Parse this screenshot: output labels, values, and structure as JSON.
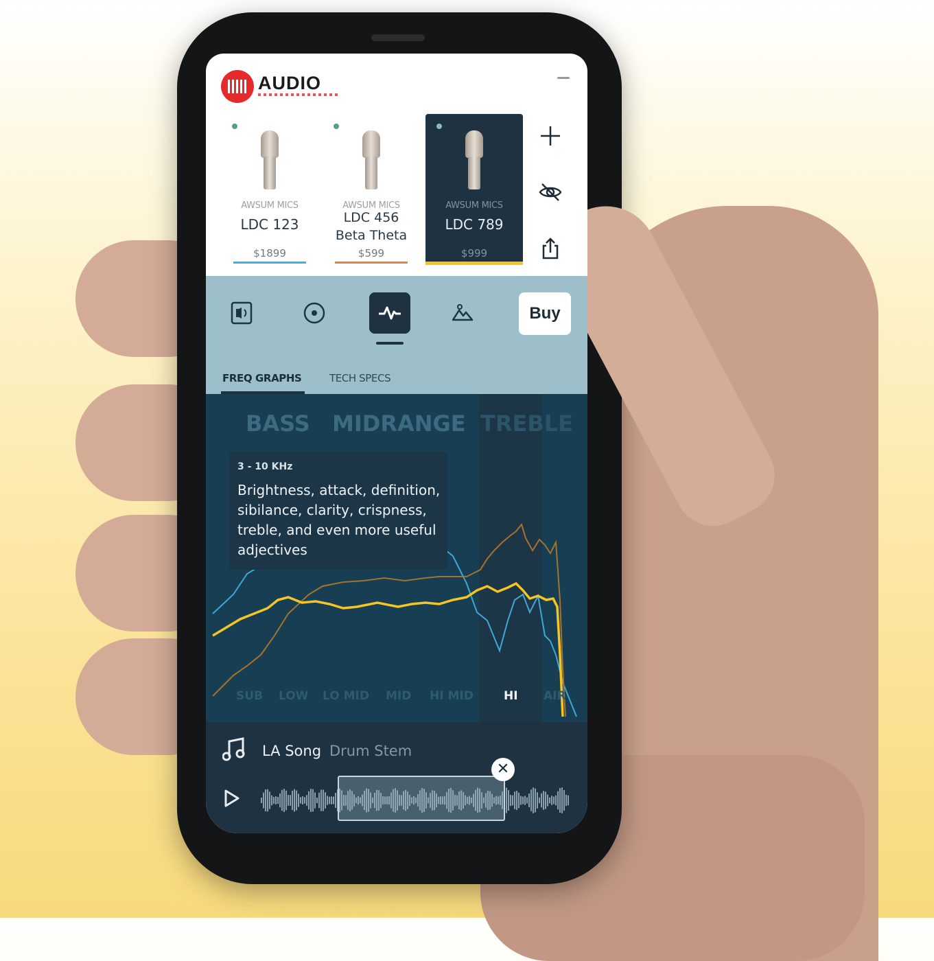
{
  "app": {
    "brand": "AUDIO",
    "logo_color": "#e32b2b"
  },
  "mics": [
    {
      "brand": "AWSUM MICS",
      "name": "LDC 123",
      "price": "$1899",
      "underline_color": "#36b6e4",
      "active": false
    },
    {
      "brand": "AWSUM MICS",
      "name": "LDC 456 Beta Theta",
      "price": "$599",
      "underline_color": "#e8833a",
      "active": false
    },
    {
      "brand": "AWSUM MICS",
      "name": "LDC 789",
      "price": "$999",
      "underline_color": "#f3c623",
      "active": true
    }
  ],
  "side_actions": [
    "add-icon",
    "hide-icon",
    "share-icon"
  ],
  "toolbar": {
    "tools": [
      "speaker-icon",
      "disc-icon",
      "waveform-icon",
      "landscape-icon"
    ],
    "active_tool": "waveform-icon",
    "buy_label": "Buy"
  },
  "subtabs": [
    {
      "label": "FREQ GRAPHS",
      "active": true
    },
    {
      "label": "TECH SPECS",
      "active": false
    }
  ],
  "graph": {
    "bands": [
      "BASS",
      "MIDRANGE",
      "TREBLE"
    ],
    "tooltip": {
      "range": "3 - 10 KHz",
      "text": "Brightness, attack, definition, sibilance, clarity, crispness, treble, and even more useful adjectives"
    },
    "ranges": [
      "SUB",
      "LOW",
      "LO MID",
      "MID",
      "HI MID",
      "HI",
      "AIR"
    ],
    "active_range": "HI",
    "series_colors": [
      "#f3c623",
      "#3ea9d6",
      "#a5722f"
    ]
  },
  "player": {
    "song": "LA Song",
    "stem": "Drum Stem"
  }
}
